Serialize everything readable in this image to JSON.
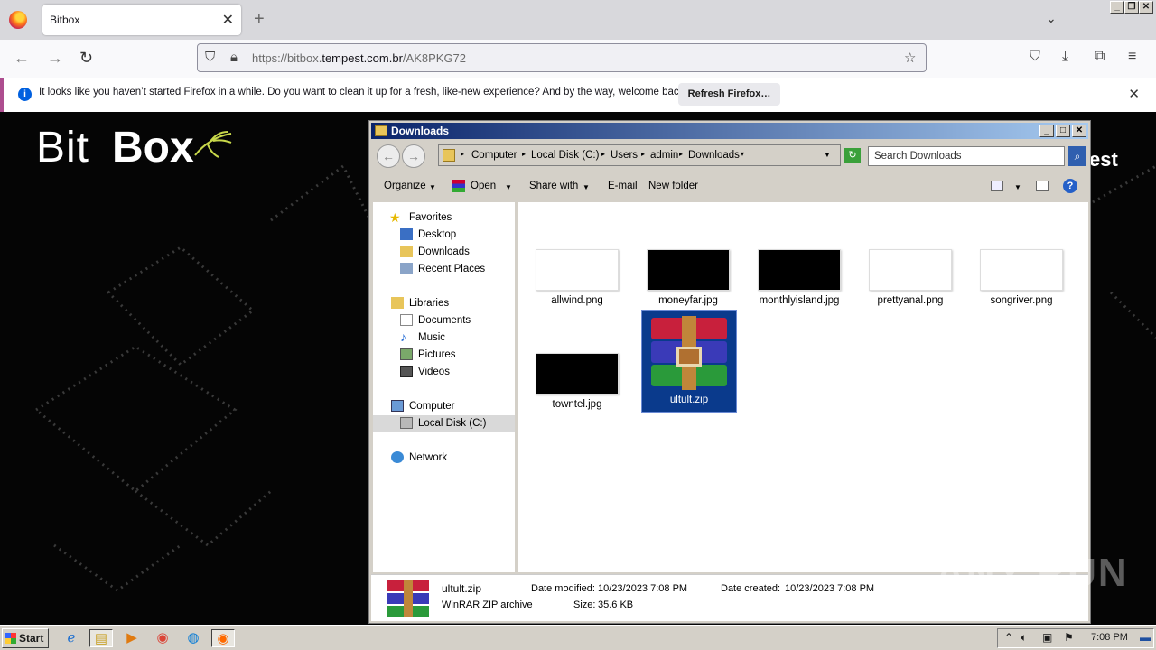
{
  "browser": {
    "tab_title": "Bitbox",
    "url_prefix": "https://bitbox.",
    "url_host": "tempest.com.br",
    "url_path": "/AK8PKG72"
  },
  "notification": {
    "message": "It looks like you haven’t started Firefox in a while. Do you want to clean it up for a fresh, like-new experience? And by the way, welcome back!",
    "button": "Refresh Firefox…"
  },
  "page": {
    "logo_bit": "Bit",
    "logo_box": "Box",
    "right_text": "est"
  },
  "explorer": {
    "title": "Downloads",
    "breadcrumb": [
      "Computer",
      "Local Disk (C:)",
      "Users",
      "admin",
      "Downloads"
    ],
    "search_placeholder": "Search Downloads",
    "commands": {
      "organize": "Organize",
      "open": "Open",
      "share_with": "Share with",
      "email": "E-mail",
      "new_folder": "New folder"
    },
    "nav": {
      "favorites": "Favorites",
      "desktop": "Desktop",
      "downloads": "Downloads",
      "recent_places": "Recent Places",
      "libraries": "Libraries",
      "documents": "Documents",
      "music": "Music",
      "pictures": "Pictures",
      "videos": "Videos",
      "computer": "Computer",
      "local_disk": "Local Disk (C:)",
      "network": "Network"
    },
    "files": [
      {
        "name": "allwind.png",
        "thumb": "white"
      },
      {
        "name": "moneyfar.jpg",
        "thumb": "black"
      },
      {
        "name": "monthlyisland.jpg",
        "thumb": "black"
      },
      {
        "name": "prettyanal.png",
        "thumb": "white"
      },
      {
        "name": "songriver.png",
        "thumb": "white"
      },
      {
        "name": "towntel.jpg",
        "thumb": "black"
      },
      {
        "name": "ultult.zip",
        "thumb": "rar"
      }
    ],
    "details": {
      "name": "ultult.zip",
      "type": "WinRAR ZIP archive",
      "modified_label": "Date modified:",
      "modified": "10/23/2023 7:08 PM",
      "size_label": "Size:",
      "size": "35.6 KB",
      "created_label": "Date created:",
      "created": "10/23/2023 7:08 PM"
    }
  },
  "taskbar": {
    "start": "Start",
    "clock": "7:08 PM"
  },
  "watermark": "ANY RUN",
  "colors": {
    "selection": "#0a3a8c",
    "titlebar": "#0a246a",
    "notif_accent": "#ad4d8f"
  }
}
